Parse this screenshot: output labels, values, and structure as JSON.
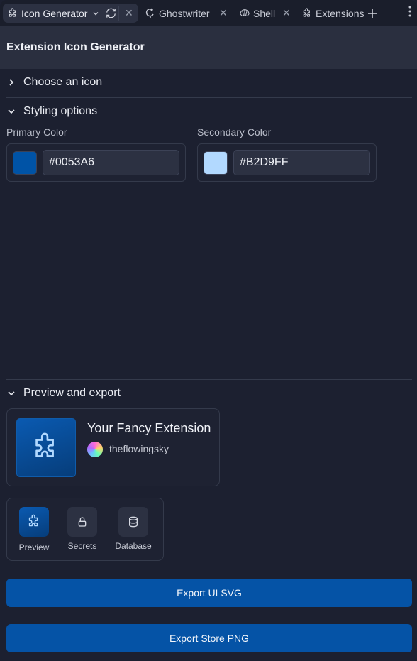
{
  "tabs": [
    {
      "label": "Icon Generator",
      "icon": "puzzle-icon"
    },
    {
      "label": "Ghostwriter",
      "icon": "ghost-icon"
    },
    {
      "label": "Shell",
      "icon": "shell-icon"
    },
    {
      "label": "Extensions",
      "icon": "puzzle-icon"
    }
  ],
  "header": {
    "title": "Extension Icon Generator"
  },
  "sections": {
    "choose_icon": "Choose an icon",
    "styling": "Styling options",
    "preview": "Preview and export"
  },
  "colors": {
    "primary_label": "Primary Color",
    "primary_value": "#0053A6",
    "secondary_label": "Secondary Color",
    "secondary_value": "#B2D9FF"
  },
  "preview": {
    "extension_name": "Your Fancy Extension",
    "author": "theflowingsky"
  },
  "preview_tabs": [
    {
      "label": "Preview",
      "icon": "puzzle-icon"
    },
    {
      "label": "Secrets",
      "icon": "lock-icon"
    },
    {
      "label": "Database",
      "icon": "database-icon"
    }
  ],
  "buttons": {
    "export_svg": "Export UI SVG",
    "export_png": "Export Store PNG"
  }
}
